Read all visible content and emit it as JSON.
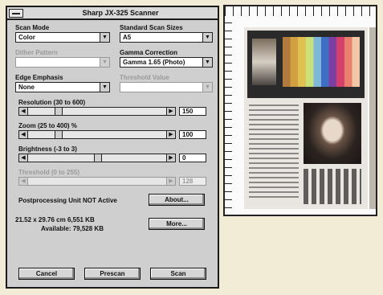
{
  "window": {
    "title": "Sharp JX-325 Scanner"
  },
  "fields": {
    "scan_mode": {
      "label": "Scan Mode",
      "value": "Color"
    },
    "standard_scan_sizes": {
      "label": "Standard Scan Sizes",
      "value": "A5"
    },
    "color_pattern": {
      "label": "Dither Pattern",
      "value": ""
    },
    "gamma_correction": {
      "label": "Gamma Correction",
      "value": "Gamma 1.65 (Photo)"
    },
    "edge_emphasis": {
      "label": "Edge Emphasis",
      "value": "None"
    },
    "threshold_level": {
      "label": "Threshold Value",
      "value": ""
    }
  },
  "sliders": {
    "resolution": {
      "label": "Resolution (30 to 600)",
      "value": "150",
      "level": 0.2
    },
    "zoom": {
      "label": "Zoom (25 to 400) %",
      "value": "100",
      "level": 0.2
    },
    "brightness": {
      "label": "Brightness (-3 to 3)",
      "value": "0",
      "level": 0.5
    },
    "threshold": {
      "label": "Threshold (0 to 255)",
      "value": "128",
      "level": 0.5
    }
  },
  "status": {
    "preprocessing": "Postprocessing Unit NOT Active",
    "size_line": "21.52 x 29.76 cm   6,551 KB",
    "available_line": "Available:  79,528 KB"
  },
  "buttons": {
    "about": "About...",
    "more": "More...",
    "cancel": "Cancel",
    "prescan": "Prescan",
    "scan": "Scan"
  },
  "colors": {
    "dialog_bg": "#cfcfcf",
    "page_bg": "#f2ecd6"
  }
}
